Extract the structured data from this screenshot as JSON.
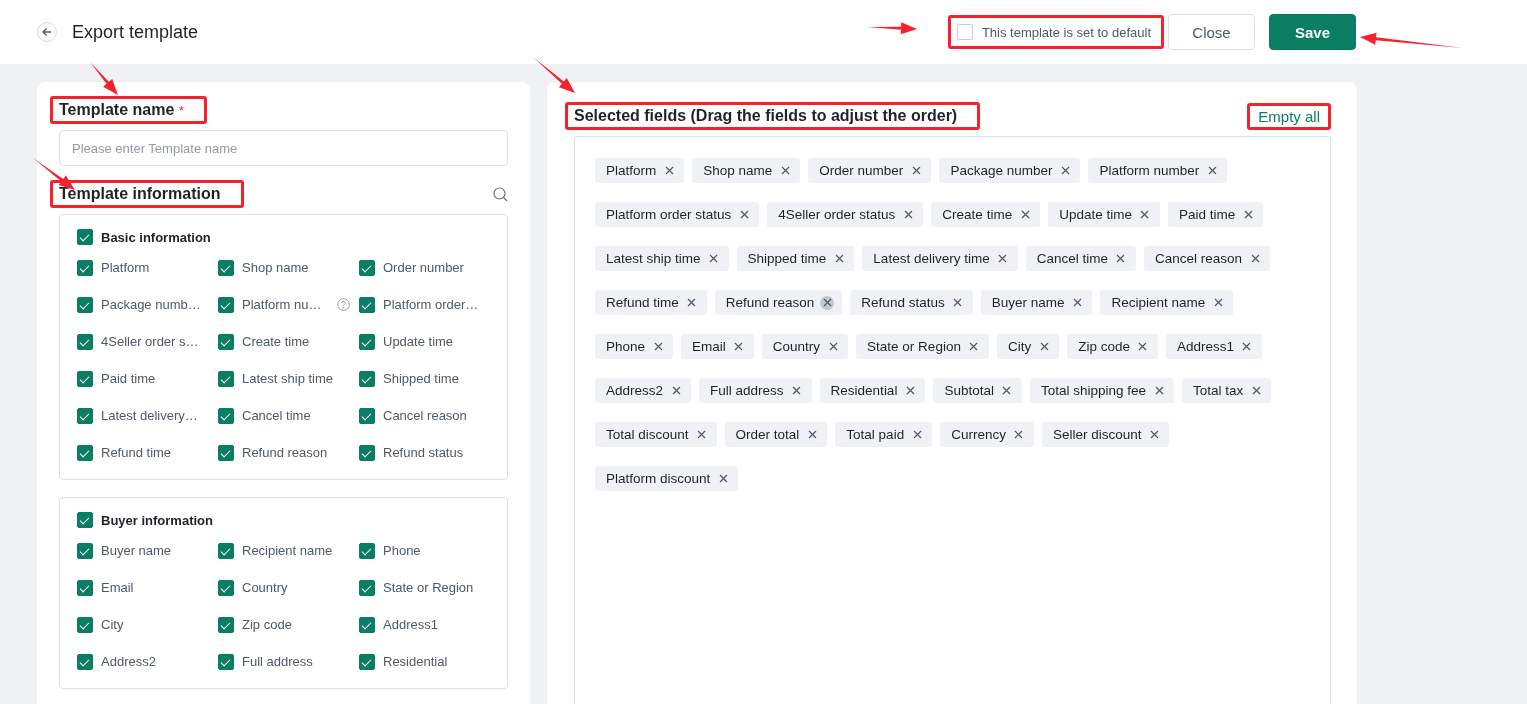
{
  "header": {
    "title": "Export template",
    "default_checkbox": {
      "label": "This template is set to default",
      "checked": false,
      "highlighted": true
    },
    "buttons": [
      {
        "label": "Close",
        "kind": "secondary",
        "highlighted": false
      },
      {
        "label": "Save",
        "kind": "primary",
        "highlighted": false
      }
    ]
  },
  "left_panel": {
    "template_name": {
      "label": "Template name",
      "required_mark": "*",
      "highlighted": true,
      "placeholder": "Please enter Template name"
    },
    "template_information": {
      "label": "Template information",
      "highlighted": true
    },
    "groups": [
      {
        "title": "Basic information",
        "checked": true,
        "fields": [
          {
            "label": "Platform",
            "checked": true
          },
          {
            "label": "Shop name",
            "checked": true
          },
          {
            "label": "Order number",
            "checked": true
          },
          {
            "label": "Package numb…",
            "checked": true
          },
          {
            "label": "Platform nu…",
            "checked": true,
            "help": true,
            "help_highlighted": false
          },
          {
            "label": "Platform order…",
            "checked": true
          },
          {
            "label": "4Seller order s…",
            "checked": true
          },
          {
            "label": "Create time",
            "checked": true
          },
          {
            "label": "Update time",
            "checked": true
          },
          {
            "label": "Paid time",
            "checked": true
          },
          {
            "label": "Latest ship time",
            "checked": true
          },
          {
            "label": "Shipped time",
            "checked": true
          },
          {
            "label": "Latest delivery…",
            "checked": true
          },
          {
            "label": "Cancel time",
            "checked": true
          },
          {
            "label": "Cancel reason",
            "checked": true
          },
          {
            "label": "Refund time",
            "checked": true
          },
          {
            "label": "Refund reason",
            "checked": true
          },
          {
            "label": "Refund status",
            "checked": true
          }
        ]
      },
      {
        "title": "Buyer information",
        "checked": true,
        "fields": [
          {
            "label": "Buyer name",
            "checked": true
          },
          {
            "label": "Recipient name",
            "checked": true
          },
          {
            "label": "Phone",
            "checked": true
          },
          {
            "label": "Email",
            "checked": true
          },
          {
            "label": "Country",
            "checked": true
          },
          {
            "label": "State or Region",
            "checked": true
          },
          {
            "label": "City",
            "checked": true
          },
          {
            "label": "Zip code",
            "checked": true
          },
          {
            "label": "Address1",
            "checked": true
          },
          {
            "label": "Address2",
            "checked": true
          },
          {
            "label": "Full address",
            "checked": true
          },
          {
            "label": "Residential",
            "checked": true
          }
        ]
      }
    ]
  },
  "right_panel": {
    "title": "Selected fields (Drag the fields to adjust the order)",
    "title_highlighted": true,
    "empty_all": {
      "label": "Empty all",
      "highlighted": true
    },
    "tags": [
      {
        "label": "Platform",
        "hovered": false
      },
      {
        "label": "Shop name",
        "hovered": false
      },
      {
        "label": "Order number",
        "hovered": false
      },
      {
        "label": "Package number",
        "hovered": false
      },
      {
        "label": "Platform number",
        "hovered": false
      },
      {
        "label": "Platform order status",
        "hovered": false
      },
      {
        "label": "4Seller order status",
        "hovered": false
      },
      {
        "label": "Create time",
        "hovered": false
      },
      {
        "label": "Update time",
        "hovered": false
      },
      {
        "label": "Paid time",
        "hovered": false
      },
      {
        "label": "Latest ship time",
        "hovered": false
      },
      {
        "label": "Shipped time",
        "hovered": false
      },
      {
        "label": "Latest delivery time",
        "hovered": false
      },
      {
        "label": "Cancel time",
        "hovered": false
      },
      {
        "label": "Cancel reason",
        "hovered": false
      },
      {
        "label": "Refund time",
        "hovered": false
      },
      {
        "label": "Refund reason",
        "hovered": true
      },
      {
        "label": "Refund status",
        "hovered": false
      },
      {
        "label": "Buyer name",
        "hovered": false
      },
      {
        "label": "Recipient name",
        "hovered": false
      },
      {
        "label": "Phone",
        "hovered": false
      },
      {
        "label": "Email",
        "hovered": false
      },
      {
        "label": "Country",
        "hovered": false
      },
      {
        "label": "State or Region",
        "hovered": false
      },
      {
        "label": "City",
        "hovered": false
      },
      {
        "label": "Zip code",
        "hovered": false
      },
      {
        "label": "Address1",
        "hovered": false
      },
      {
        "label": "Address2",
        "hovered": false
      },
      {
        "label": "Full address",
        "hovered": false
      },
      {
        "label": "Residential",
        "hovered": false
      },
      {
        "label": "Subtotal",
        "hovered": false
      },
      {
        "label": "Total shipping fee",
        "hovered": false
      },
      {
        "label": "Total tax",
        "hovered": false
      },
      {
        "label": "Total discount",
        "hovered": false
      },
      {
        "label": "Order total",
        "hovered": false
      },
      {
        "label": "Total paid",
        "hovered": false
      },
      {
        "label": "Currency",
        "hovered": false
      },
      {
        "label": "Seller discount",
        "hovered": false
      },
      {
        "label": "Platform discount",
        "hovered": false
      }
    ]
  }
}
